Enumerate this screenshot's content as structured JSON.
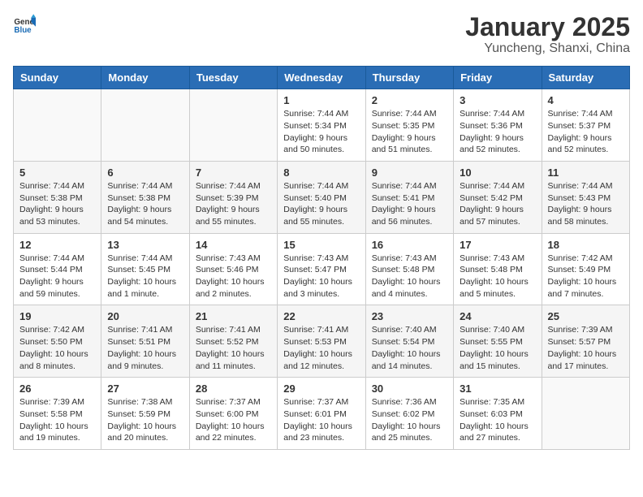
{
  "header": {
    "logo_general": "General",
    "logo_blue": "Blue",
    "title": "January 2025",
    "subtitle": "Yuncheng, Shanxi, China"
  },
  "weekdays": [
    "Sunday",
    "Monday",
    "Tuesday",
    "Wednesday",
    "Thursday",
    "Friday",
    "Saturday"
  ],
  "weeks": [
    [
      {
        "day": "",
        "detail": ""
      },
      {
        "day": "",
        "detail": ""
      },
      {
        "day": "",
        "detail": ""
      },
      {
        "day": "1",
        "detail": "Sunrise: 7:44 AM\nSunset: 5:34 PM\nDaylight: 9 hours\nand 50 minutes."
      },
      {
        "day": "2",
        "detail": "Sunrise: 7:44 AM\nSunset: 5:35 PM\nDaylight: 9 hours\nand 51 minutes."
      },
      {
        "day": "3",
        "detail": "Sunrise: 7:44 AM\nSunset: 5:36 PM\nDaylight: 9 hours\nand 52 minutes."
      },
      {
        "day": "4",
        "detail": "Sunrise: 7:44 AM\nSunset: 5:37 PM\nDaylight: 9 hours\nand 52 minutes."
      }
    ],
    [
      {
        "day": "5",
        "detail": "Sunrise: 7:44 AM\nSunset: 5:38 PM\nDaylight: 9 hours\nand 53 minutes."
      },
      {
        "day": "6",
        "detail": "Sunrise: 7:44 AM\nSunset: 5:38 PM\nDaylight: 9 hours\nand 54 minutes."
      },
      {
        "day": "7",
        "detail": "Sunrise: 7:44 AM\nSunset: 5:39 PM\nDaylight: 9 hours\nand 55 minutes."
      },
      {
        "day": "8",
        "detail": "Sunrise: 7:44 AM\nSunset: 5:40 PM\nDaylight: 9 hours\nand 55 minutes."
      },
      {
        "day": "9",
        "detail": "Sunrise: 7:44 AM\nSunset: 5:41 PM\nDaylight: 9 hours\nand 56 minutes."
      },
      {
        "day": "10",
        "detail": "Sunrise: 7:44 AM\nSunset: 5:42 PM\nDaylight: 9 hours\nand 57 minutes."
      },
      {
        "day": "11",
        "detail": "Sunrise: 7:44 AM\nSunset: 5:43 PM\nDaylight: 9 hours\nand 58 minutes."
      }
    ],
    [
      {
        "day": "12",
        "detail": "Sunrise: 7:44 AM\nSunset: 5:44 PM\nDaylight: 9 hours\nand 59 minutes."
      },
      {
        "day": "13",
        "detail": "Sunrise: 7:44 AM\nSunset: 5:45 PM\nDaylight: 10 hours\nand 1 minute."
      },
      {
        "day": "14",
        "detail": "Sunrise: 7:43 AM\nSunset: 5:46 PM\nDaylight: 10 hours\nand 2 minutes."
      },
      {
        "day": "15",
        "detail": "Sunrise: 7:43 AM\nSunset: 5:47 PM\nDaylight: 10 hours\nand 3 minutes."
      },
      {
        "day": "16",
        "detail": "Sunrise: 7:43 AM\nSunset: 5:48 PM\nDaylight: 10 hours\nand 4 minutes."
      },
      {
        "day": "17",
        "detail": "Sunrise: 7:43 AM\nSunset: 5:48 PM\nDaylight: 10 hours\nand 5 minutes."
      },
      {
        "day": "18",
        "detail": "Sunrise: 7:42 AM\nSunset: 5:49 PM\nDaylight: 10 hours\nand 7 minutes."
      }
    ],
    [
      {
        "day": "19",
        "detail": "Sunrise: 7:42 AM\nSunset: 5:50 PM\nDaylight: 10 hours\nand 8 minutes."
      },
      {
        "day": "20",
        "detail": "Sunrise: 7:41 AM\nSunset: 5:51 PM\nDaylight: 10 hours\nand 9 minutes."
      },
      {
        "day": "21",
        "detail": "Sunrise: 7:41 AM\nSunset: 5:52 PM\nDaylight: 10 hours\nand 11 minutes."
      },
      {
        "day": "22",
        "detail": "Sunrise: 7:41 AM\nSunset: 5:53 PM\nDaylight: 10 hours\nand 12 minutes."
      },
      {
        "day": "23",
        "detail": "Sunrise: 7:40 AM\nSunset: 5:54 PM\nDaylight: 10 hours\nand 14 minutes."
      },
      {
        "day": "24",
        "detail": "Sunrise: 7:40 AM\nSunset: 5:55 PM\nDaylight: 10 hours\nand 15 minutes."
      },
      {
        "day": "25",
        "detail": "Sunrise: 7:39 AM\nSunset: 5:57 PM\nDaylight: 10 hours\nand 17 minutes."
      }
    ],
    [
      {
        "day": "26",
        "detail": "Sunrise: 7:39 AM\nSunset: 5:58 PM\nDaylight: 10 hours\nand 19 minutes."
      },
      {
        "day": "27",
        "detail": "Sunrise: 7:38 AM\nSunset: 5:59 PM\nDaylight: 10 hours\nand 20 minutes."
      },
      {
        "day": "28",
        "detail": "Sunrise: 7:37 AM\nSunset: 6:00 PM\nDaylight: 10 hours\nand 22 minutes."
      },
      {
        "day": "29",
        "detail": "Sunrise: 7:37 AM\nSunset: 6:01 PM\nDaylight: 10 hours\nand 23 minutes."
      },
      {
        "day": "30",
        "detail": "Sunrise: 7:36 AM\nSunset: 6:02 PM\nDaylight: 10 hours\nand 25 minutes."
      },
      {
        "day": "31",
        "detail": "Sunrise: 7:35 AM\nSunset: 6:03 PM\nDaylight: 10 hours\nand 27 minutes."
      },
      {
        "day": "",
        "detail": ""
      }
    ]
  ]
}
